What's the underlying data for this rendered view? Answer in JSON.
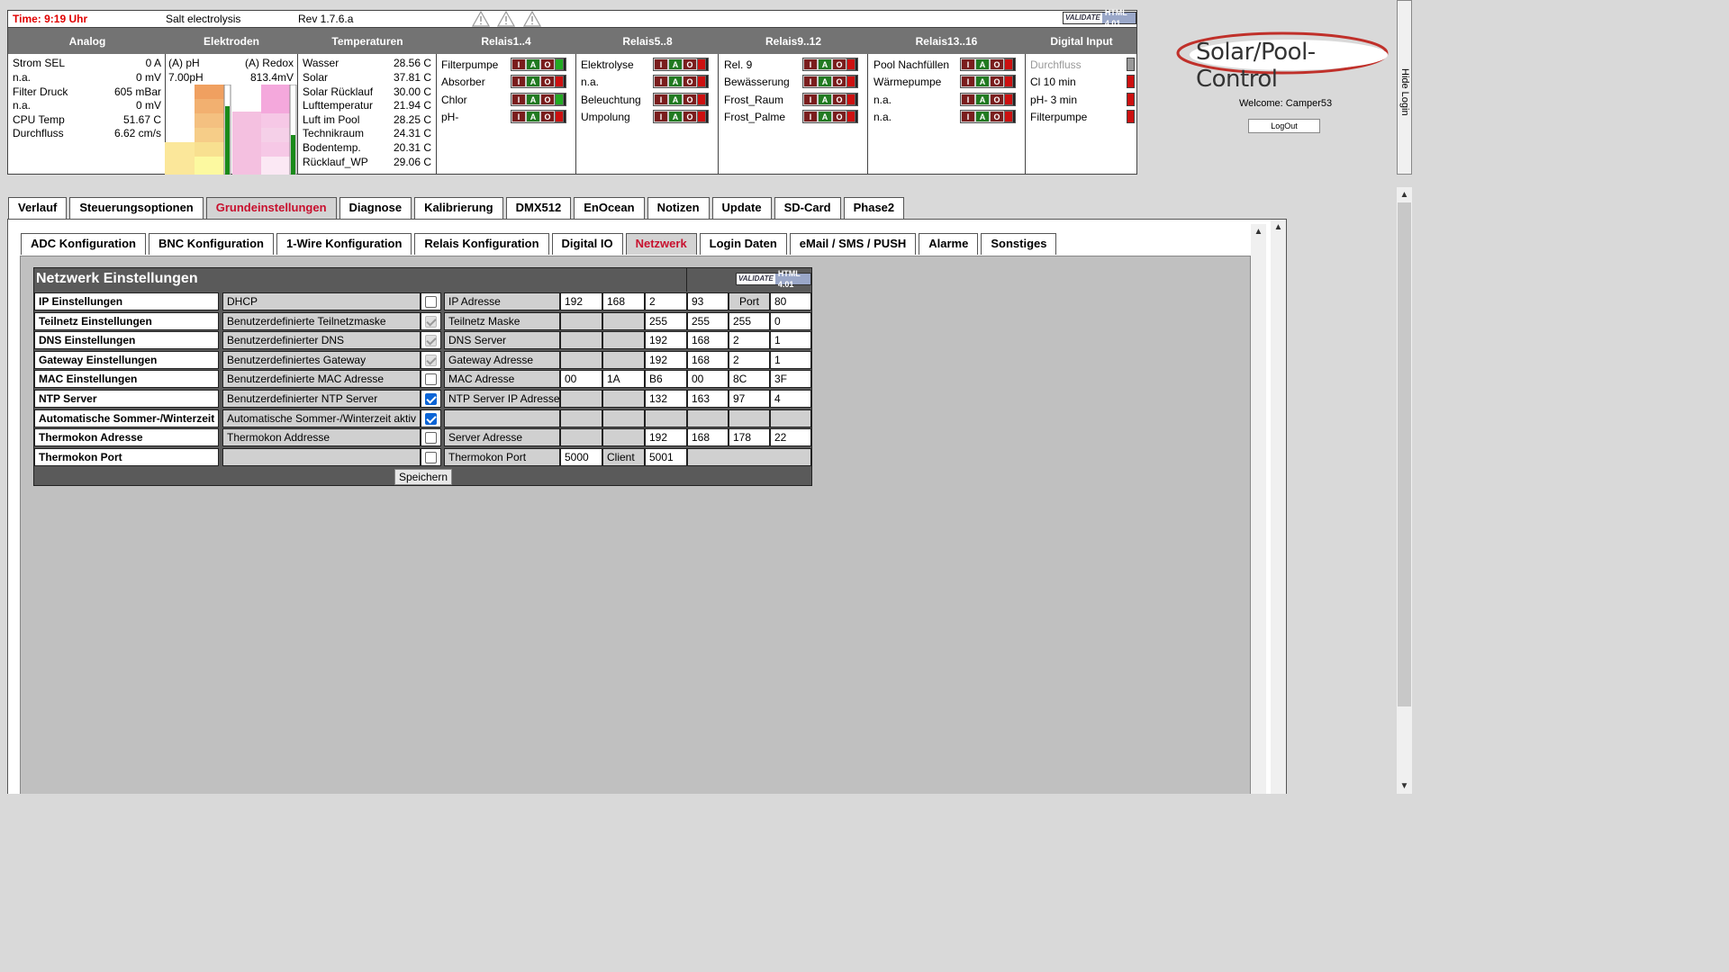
{
  "topbar": {
    "time": "Time: 9:19 Uhr",
    "device": "Salt electrolysis",
    "rev": "Rev 1.7.6.a",
    "valid_a": "VALIDATE",
    "valid_b": "HTML 4.01"
  },
  "status": {
    "headers": [
      "Analog",
      "Elektroden",
      "Temperaturen",
      "Relais1..4",
      "Relais5..8",
      "Relais9..12",
      "Relais13..16",
      "Digital Input"
    ],
    "analog": [
      {
        "label": "Strom SEL",
        "value": "0 A"
      },
      {
        "label": "n.a.",
        "value": "0 mV"
      },
      {
        "label": "Filter Druck",
        "value": "605 mBar"
      },
      {
        "label": "n.a.",
        "value": "0 mV"
      },
      {
        "label": "CPU Temp",
        "value": "51.67 C"
      },
      {
        "label": "Durchfluss",
        "value": "6.62 cm/s"
      }
    ],
    "electrodes": {
      "ph_label": "(A) pH",
      "redox_label": "(A) Redox",
      "ph_value": "7.00pH",
      "redox_value": "813.4mV"
    },
    "temperatures": [
      {
        "label": "Wasser",
        "value": "28.56 C"
      },
      {
        "label": "Solar",
        "value": "37.81 C"
      },
      {
        "label": "Solar Rücklauf",
        "value": "30.00 C"
      },
      {
        "label": "Lufttemperatur",
        "value": "21.94 C"
      },
      {
        "label": "Luft im Pool",
        "value": "28.25 C"
      },
      {
        "label": "Technikraum",
        "value": "24.31 C"
      },
      {
        "label": "Bodentemp.",
        "value": "20.31 C"
      },
      {
        "label": "Rücklauf_WP",
        "value": "29.06 C"
      }
    ],
    "relais1": [
      "Filterpumpe",
      "Absorber",
      "Chlor",
      "pH-"
    ],
    "relais5": [
      "Elektrolyse",
      "n.a.",
      "Beleuchtung",
      "Umpolung"
    ],
    "relais9": [
      "Rel. 9",
      "Bewässerung",
      "Frost_Raum",
      "Frost_Palme"
    ],
    "relais13": [
      "Pool Nachfüllen",
      "Wärmepumpe",
      "n.a.",
      "n.a."
    ],
    "digital": [
      "Durchfluss",
      "Cl 10 min",
      "pH- 3 min",
      "Filterpumpe"
    ],
    "iao": {
      "i": "I",
      "a": "A",
      "o": "O"
    }
  },
  "login": {
    "welcome": "Welcome: Camper53",
    "logout": "LogOut",
    "hide": "Hide Login",
    "logo": "Solar/Pool-Control"
  },
  "tabs": [
    "Verlauf",
    "Steuerungsoptionen",
    "Grundeinstellungen",
    "Diagnose",
    "Kalibrierung",
    "DMX512",
    "EnOcean",
    "Notizen",
    "Update",
    "SD-Card",
    "Phase2"
  ],
  "subtabs": [
    "ADC Konfiguration",
    "BNC Konfiguration",
    "1-Wire Konfiguration",
    "Relais Konfiguration",
    "Digital IO",
    "Netzwerk",
    "Login Daten",
    "eMail / SMS / PUSH",
    "Alarme",
    "Sonstiges"
  ],
  "network": {
    "title": "Netzwerk Einstellungen",
    "rows": [
      {
        "label": "IP Einstellungen",
        "desc": "DHCP",
        "field": "IP Adresse",
        "v": [
          "192",
          "168",
          "2",
          "93",
          "Port",
          "80"
        ]
      },
      {
        "label": "Teilnetz Einstellungen",
        "desc": "Benutzerdefinierte Teilnetzmaske",
        "field": "Teilnetz Maske",
        "v": [
          "",
          "",
          "255",
          "255",
          "255",
          "0"
        ]
      },
      {
        "label": "DNS Einstellungen",
        "desc": "Benutzerdefinierter DNS",
        "field": "DNS Server",
        "v": [
          "",
          "",
          "192",
          "168",
          "2",
          "1"
        ]
      },
      {
        "label": "Gateway Einstellungen",
        "desc": "Benutzerdefiniertes Gateway",
        "field": "Gateway Adresse",
        "v": [
          "",
          "",
          "192",
          "168",
          "2",
          "1"
        ]
      },
      {
        "label": "MAC Einstellungen",
        "desc": "Benutzerdefinierte MAC Adresse",
        "field": "MAC Adresse",
        "v": [
          "00",
          "1A",
          "B6",
          "00",
          "8C",
          "3F"
        ]
      },
      {
        "label": "NTP Server",
        "desc": "Benutzerdefinierter NTP Server",
        "field": "NTP Server IP Adresse",
        "v": [
          "",
          "",
          "132",
          "163",
          "97",
          "4"
        ]
      },
      {
        "label": "Automatische Sommer-/Winterzeit",
        "desc": "Automatische Sommer-/Winterzeit aktiv",
        "field": "",
        "v": [
          "",
          "",
          "",
          "",
          "",
          ""
        ]
      },
      {
        "label": "Thermokon Adresse",
        "desc": "Thermokon Addresse",
        "field": "Server Adresse",
        "v": [
          "",
          "",
          "192",
          "168",
          "178",
          "22"
        ]
      },
      {
        "label": "Thermokon Port",
        "desc": "",
        "field": "Thermokon Port",
        "v": [
          "5000",
          "Client",
          "5001"
        ]
      }
    ],
    "save": "Speichern"
  }
}
